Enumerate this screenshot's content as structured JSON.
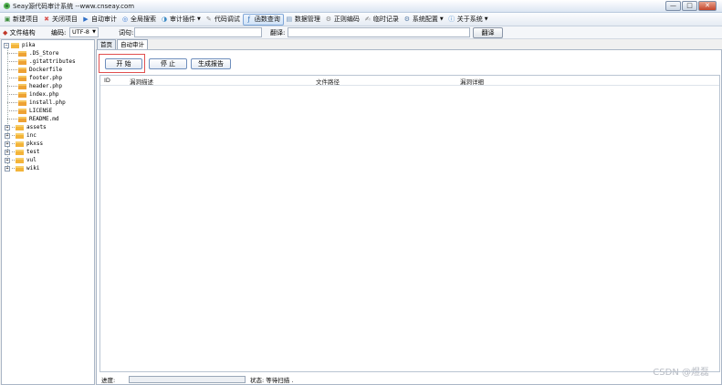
{
  "window": {
    "title": "Seay源代码审计系统 --www.cnseay.com",
    "minimize": "—",
    "maximize": "□",
    "close": "✕"
  },
  "menu": [
    {
      "icon": "▣",
      "label": "新建项目",
      "color": "#3c8d3c"
    },
    {
      "icon": "✖",
      "label": "关闭项目",
      "color": "#d9534f"
    },
    {
      "icon": "▶",
      "label": "自动审计",
      "color": "#2f6fc7"
    },
    {
      "icon": "◎",
      "label": "全局搜索",
      "color": "#3a7bd5"
    },
    {
      "icon": "◑",
      "label": "审计插件",
      "color": "#3d8bc4",
      "dropdown": true
    },
    {
      "icon": "✎",
      "label": "代码调试",
      "color": "#888"
    },
    {
      "icon": "ƒ",
      "label": "函数查询",
      "color": "#2e6db4",
      "active": true
    },
    {
      "icon": "▤",
      "label": "数据管理",
      "color": "#6a8fb8"
    },
    {
      "icon": "⚙",
      "label": "正则编码",
      "color": "#888"
    },
    {
      "icon": "✍",
      "label": "临时记录",
      "color": "#777"
    },
    {
      "icon": "⚙",
      "label": "系统配置",
      "color": "#5c7fa8",
      "dropdown": true
    },
    {
      "icon": "ⓘ",
      "label": "关于系统",
      "color": "#4a8ed0",
      "dropdown": true
    }
  ],
  "toolbar2": {
    "file_structure": "文件结构",
    "encoding_label": "编码:",
    "encoding_value": "UTF-8",
    "word_label": "词句:",
    "translate_label": "翻译:",
    "translate_button": "翻译"
  },
  "tree": {
    "root": "pika",
    "items": [
      {
        "label": ".DS_Store",
        "type": "file"
      },
      {
        "label": ".gitattributes",
        "type": "file"
      },
      {
        "label": "Dockerfile",
        "type": "file"
      },
      {
        "label": "footer.php",
        "type": "file"
      },
      {
        "label": "header.php",
        "type": "file"
      },
      {
        "label": "index.php",
        "type": "file"
      },
      {
        "label": "install.php",
        "type": "file"
      },
      {
        "label": "LICENSE",
        "type": "file"
      },
      {
        "label": "README.md",
        "type": "file"
      },
      {
        "label": "assets",
        "type": "folder"
      },
      {
        "label": "inc",
        "type": "folder"
      },
      {
        "label": "pkxss",
        "type": "folder"
      },
      {
        "label": "test",
        "type": "folder"
      },
      {
        "label": "vul",
        "type": "folder"
      },
      {
        "label": "wiki",
        "type": "folder"
      }
    ]
  },
  "tabs": [
    {
      "label": "首页"
    },
    {
      "label": "自动审计",
      "active": true
    }
  ],
  "panel": {
    "start_button": "开 始",
    "stop_button": "停 止",
    "report_button": "生成报告",
    "columns": [
      "ID",
      "漏洞描述",
      "文件路径",
      "漏洞详细"
    ],
    "progress_label": "进度:",
    "progress_value": 0,
    "status_text": "状态: 等待扫描 ."
  },
  "watermark": "CSDN @煜磊"
}
